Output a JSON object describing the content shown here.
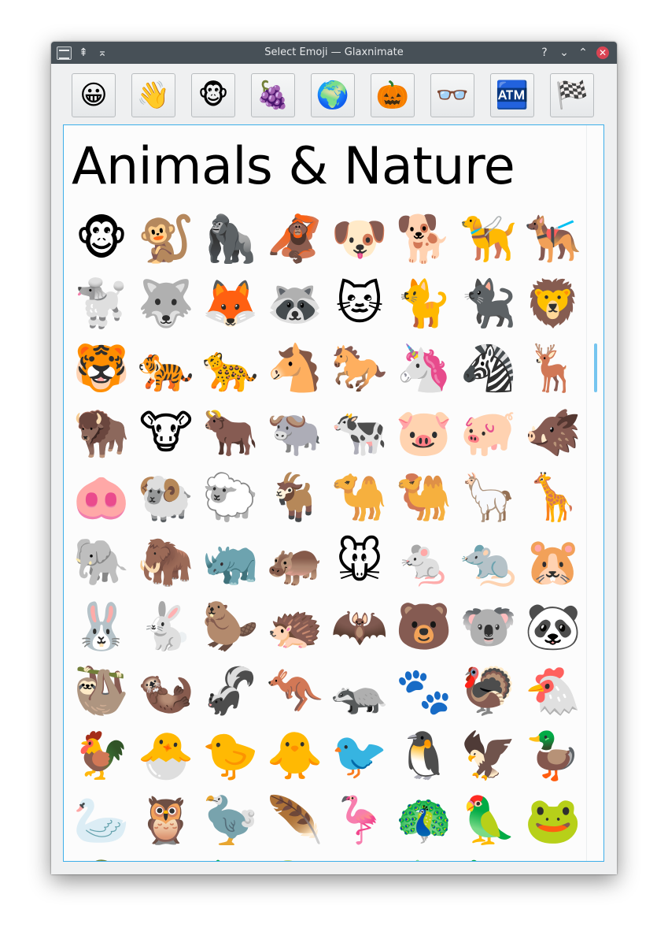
{
  "window": {
    "title": "Select Emoji — Glaxnimate",
    "buttons": {
      "help": "?",
      "minimize": "⌄",
      "maximize": "⌃",
      "close": "✕",
      "keep_above": "⇞",
      "shade": "⌅"
    }
  },
  "categories": [
    {
      "name": "smileys-category",
      "glyph": "😀"
    },
    {
      "name": "people-category",
      "glyph": "👋"
    },
    {
      "name": "animals-category",
      "glyph": "🐵"
    },
    {
      "name": "food-category",
      "glyph": "🍇"
    },
    {
      "name": "travel-category",
      "glyph": "🌍"
    },
    {
      "name": "activities-category",
      "glyph": "🎃"
    },
    {
      "name": "objects-category",
      "glyph": "👓"
    },
    {
      "name": "symbols-category",
      "glyph": "🏧"
    },
    {
      "name": "flags-category",
      "glyph": "🏁"
    }
  ],
  "section": {
    "heading": "Animals & Nature"
  },
  "emoji_rows": [
    [
      "🐵",
      "🐒",
      "🦍",
      "🦧",
      "🐶",
      "🐕",
      "🦮",
      "🐕‍🦺"
    ],
    [
      "🐩",
      "🐺",
      "🦊",
      "🦝",
      "🐱",
      "🐈",
      "🐈‍⬛",
      "🦁"
    ],
    [
      "🐯",
      "🐅",
      "🐆",
      "🐴",
      "🐎",
      "🦄",
      "🦓",
      "🦌"
    ],
    [
      "🦬",
      "🐮",
      "🐂",
      "🐃",
      "🐄",
      "🐷",
      "🐖",
      "🐗"
    ],
    [
      "🐽",
      "🐏",
      "🐑",
      "🐐",
      "🐪",
      "🐫",
      "🦙",
      "🦒"
    ],
    [
      "🐘",
      "🦣",
      "🦏",
      "🦛",
      "🐭",
      "🐁",
      "🐀",
      "🐹"
    ],
    [
      "🐰",
      "🐇",
      "🦫",
      "🦔",
      "🦇",
      "🐻",
      "🐨",
      "🐼"
    ],
    [
      "🦥",
      "🦦",
      "🦨",
      "🦘",
      "🦡",
      "🐾",
      "🦃",
      "🐔"
    ],
    [
      "🐓",
      "🐣",
      "🐤",
      "🐥",
      "🐦",
      "🐧",
      "🦅",
      "🦆"
    ],
    [
      "🦢",
      "🦉",
      "🦤",
      "🪶",
      "🦩",
      "🦚",
      "🦜",
      "🐸"
    ],
    [
      "🐊",
      "🐢",
      "🦎",
      "🐍",
      "🐲",
      "🐉",
      "🦕",
      "🦖"
    ]
  ],
  "colors": {
    "titlebar": "#475057",
    "accent": "#3daee9",
    "close": "#da4453",
    "window_bg": "#eff0f1"
  }
}
